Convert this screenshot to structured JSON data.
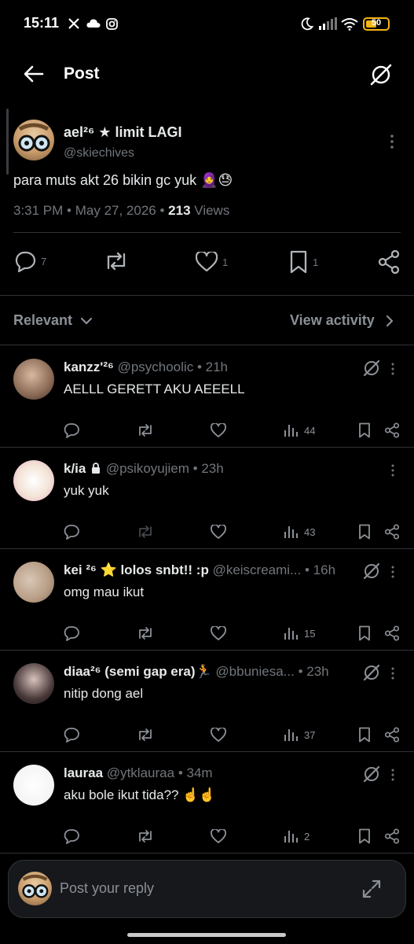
{
  "status_bar": {
    "time": "15:11",
    "battery": "50"
  },
  "header": {
    "title": "Post"
  },
  "post": {
    "display_name": "ael²⁶ ★ limit LAGI",
    "handle": "@skiechives",
    "text": "para muts akt 26 bikin gc yuk 🧕😓",
    "time": "3:31 PM",
    "date": "May 27, 2026",
    "views_count": "213",
    "views_label": "Views",
    "replies": "7",
    "reposts": "",
    "likes": "1",
    "bookmarks": "1"
  },
  "sort": {
    "label": "Relevant",
    "activity_label": "View activity"
  },
  "replies": [
    {
      "name": "kanzz'²⁶",
      "handle": "@psychoolic",
      "time": "21h",
      "text": "AELLL GERETT AKU AEEELL",
      "views": "44",
      "grok": true,
      "lock": false
    },
    {
      "name": "k/ia",
      "handle": "@psikoyujiem",
      "time": "23h",
      "text": "yuk yuk",
      "views": "43",
      "grok": false,
      "lock": true
    },
    {
      "name": "kei ²⁶ ⭐ lolos snbt!! :p",
      "handle": "@keiscreami...",
      "time": "16h",
      "text": "omg mau ikut",
      "views": "15",
      "grok": true,
      "lock": false
    },
    {
      "name": "diaa²⁶ (semi gap era)🏃",
      "handle": "@bbuniesa...",
      "time": "23h",
      "text": "nitip dong ael",
      "views": "37",
      "grok": true,
      "lock": false
    },
    {
      "name": "lauraa",
      "handle": "@ytklauraa",
      "time": "34m",
      "text": "aku bole ikut tida?? ☝️☝️",
      "views": "2",
      "grok": true,
      "lock": false
    }
  ],
  "reply_bar": {
    "placeholder": "Post your reply"
  }
}
